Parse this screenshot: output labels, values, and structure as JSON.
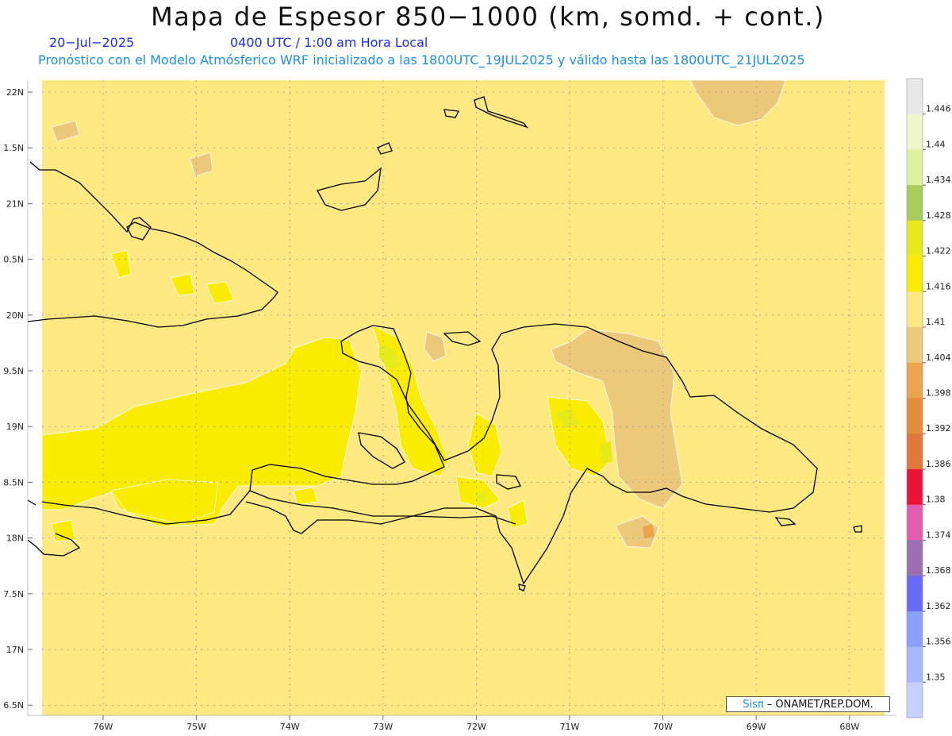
{
  "title": "Mapa de Espesor 850−1000 (km, somd. + cont.)",
  "date_label": "20−Jul−2025",
  "time_label": "0400 UTC / 1:00 am Hora Local",
  "subtitle": "Pronóstico con el Modelo Atmósferico WRF inicializado a las 1800UTC_19JUL2025 y válido hasta las  1800UTC_21JUL2025",
  "credit": {
    "logo": "Sisπ",
    "text": " – ONAMET/REP.DOM."
  },
  "axes": {
    "lat_labels": [
      "22N",
      "1.5N",
      "21N",
      "0.5N",
      "20N",
      "9.5N",
      "19N",
      "8.5N",
      "18N",
      "7.5N",
      "17N",
      "6.5N"
    ],
    "lon_labels": [
      "76W",
      "75W",
      "74W",
      "73W",
      "72W",
      "71W",
      "70W",
      "69W",
      "68W"
    ]
  },
  "colorbar": {
    "labels": [
      "1.446",
      "1.44",
      "1.434",
      "1.428",
      "1.422",
      "1.416",
      "1.41",
      "1.404",
      "1.398",
      "1.392",
      "1.386",
      "1.38",
      "1.374",
      "1.368",
      "1.362",
      "1.356",
      "1.35"
    ],
    "colors": [
      "#e8e8e8",
      "#f0f5cc",
      "#dff0a0",
      "#a8cc5a",
      "#e6ea1a",
      "#faec00",
      "#fde882",
      "#ecc87a",
      "#eaa44c",
      "#e68c3c",
      "#df783a",
      "#ec1436",
      "#e25cb0",
      "#9a70b0",
      "#6a6af8",
      "#8aa0fc",
      "#a8b8fd",
      "#c6d0fe"
    ]
  },
  "colors": {
    "background": "#fde882",
    "coast": "#000000",
    "grid": "#a0a0a0",
    "title": "#111111",
    "date": "#1b2ee8",
    "subtitle": "#1c8fe0"
  }
}
